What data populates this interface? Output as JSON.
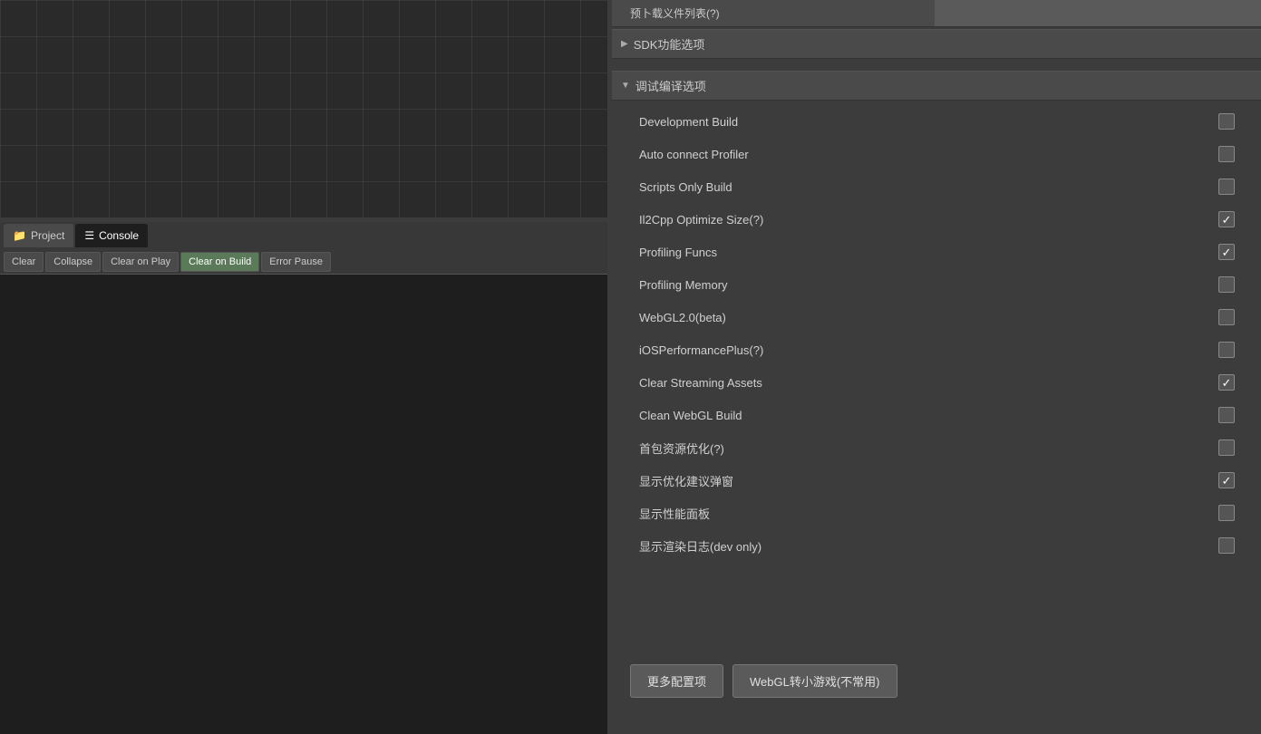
{
  "preload": {
    "label": "预卜载义件列表(?)",
    "value": ""
  },
  "sdk_section": {
    "arrow": "▶",
    "label": "SDK功能选项"
  },
  "debug_section": {
    "arrow": "▼",
    "label": "调试编译选项"
  },
  "options": [
    {
      "id": "development-build",
      "label": "Development Build",
      "checked": false
    },
    {
      "id": "auto-connect-profiler",
      "label": "Auto connect Profiler",
      "checked": false
    },
    {
      "id": "scripts-only-build",
      "label": "Scripts Only Build",
      "checked": false
    },
    {
      "id": "il2cpp-optimize-size",
      "label": "Il2Cpp Optimize Size(?)",
      "checked": true
    },
    {
      "id": "profiling-funcs",
      "label": "Profiling Funcs",
      "checked": true
    },
    {
      "id": "profiling-memory",
      "label": "Profiling Memory",
      "checked": false
    },
    {
      "id": "webgl2-beta",
      "label": "WebGL2.0(beta)",
      "checked": false
    },
    {
      "id": "ios-performance-plus",
      "label": "iOSPerformancePlus(?)",
      "checked": false
    },
    {
      "id": "clear-streaming-assets",
      "label": "Clear Streaming Assets",
      "checked": true
    },
    {
      "id": "clean-webgl-build",
      "label": "Clean WebGL Build",
      "checked": false
    },
    {
      "id": "first-package-optimization",
      "label": "首包资源优化(?)",
      "checked": false
    },
    {
      "id": "show-optimization-dialog",
      "label": "显示优化建议弹窗",
      "checked": true
    },
    {
      "id": "show-performance-panel",
      "label": "显示性能面板",
      "checked": false
    },
    {
      "id": "show-render-log",
      "label": "显示渲染日志(dev only)",
      "checked": false
    }
  ],
  "tabs": [
    {
      "id": "project",
      "icon": "📁",
      "label": "Project"
    },
    {
      "id": "console",
      "icon": "☰",
      "label": "Console"
    }
  ],
  "toolbar_buttons": [
    {
      "id": "clear",
      "label": "Clear"
    },
    {
      "id": "collapse",
      "label": "Collapse"
    },
    {
      "id": "clear-on-play",
      "label": "Clear on Play"
    },
    {
      "id": "clear-on-build",
      "label": "Clear on Build"
    },
    {
      "id": "error-pause",
      "label": "Error Pause"
    }
  ],
  "bottom_buttons": [
    {
      "id": "more-config",
      "label": "更多配置项"
    },
    {
      "id": "webgl-convert",
      "label": "WebGL转小游戏(不常用)"
    }
  ]
}
